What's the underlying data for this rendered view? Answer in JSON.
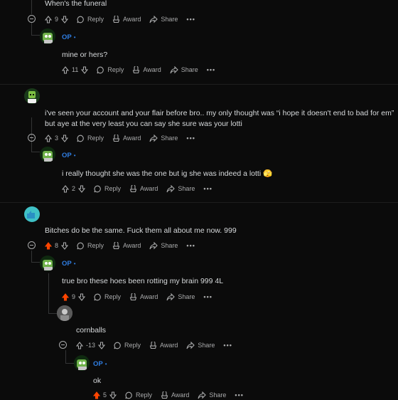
{
  "comments": [
    {
      "text": "When's the funeral",
      "score": "9",
      "upvoted": false
    },
    {
      "author": "OP",
      "text": "mine or hers?",
      "score": "11",
      "upvoted": false
    },
    {
      "text_line1": "i've seen your account and your flair before bro.. my only thought was “i hope it doesn't end to bad for em”",
      "text_line2": "but aye at the very least you can say she sure was your lotti",
      "score": "3",
      "upvoted": false
    },
    {
      "author": "OP",
      "text": "i really thought she was the one but ig she was indeed a lotti 🫣",
      "score": "2",
      "upvoted": false
    },
    {
      "text": "Bitches do be the same. Fuck them all about me now. 999",
      "score": "8",
      "upvoted": true
    },
    {
      "author": "OP",
      "text": "true bro these hoes been rotting my brain 999 4L",
      "score": "9",
      "upvoted": true
    },
    {
      "text": "cornballs",
      "score": "-13",
      "upvoted": false
    },
    {
      "author": "OP",
      "text": "ok",
      "score": "5",
      "upvoted": true
    }
  ],
  "labels": {
    "reply": "Reply",
    "award": "Award",
    "share": "Share",
    "more": "•••",
    "op_dot": "•"
  },
  "colors": {
    "background": "#0b0b0b",
    "upvote_active": "#ff4500",
    "op": "#2f7de1"
  }
}
